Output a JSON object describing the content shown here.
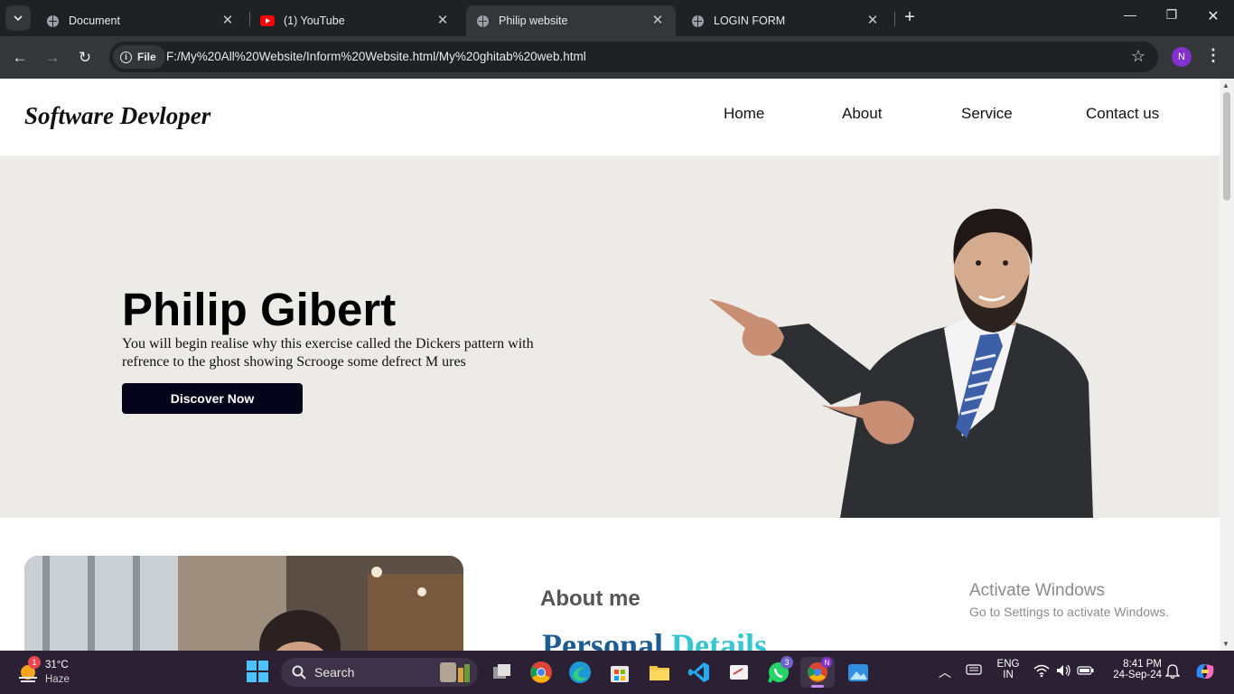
{
  "browser": {
    "tabs": [
      {
        "title": "Document",
        "icon": "globe-icon"
      },
      {
        "title": "(1) YouTube",
        "icon": "youtube-icon"
      },
      {
        "title": "Philip website",
        "icon": "globe-icon",
        "active": true
      },
      {
        "title": "LOGIN FORM",
        "icon": "globe-icon"
      }
    ],
    "chip_label": "File",
    "url": "F:/My%20All%20Website/Inform%20Website.html/My%20ghitab%20web.html",
    "profile_initial": "N"
  },
  "site": {
    "logo": "Software Devloper",
    "nav": [
      "Home",
      "About",
      "Service",
      "Contact us"
    ],
    "hero": {
      "name": "Philip Gibert",
      "text": "You will begin realise why this exercise called the Dickers pattern with refrence to the ghost showing Scrooge some defrect M ures",
      "button": "Discover Now"
    },
    "about": {
      "title": "About me",
      "subtitle_a": "Personal",
      "subtitle_b": "Details"
    }
  },
  "watermark": {
    "line1": "Activate Windows",
    "line2": "Go to Settings to activate Windows."
  },
  "taskbar": {
    "weather_temp": "31°C",
    "weather_desc": "Haze",
    "weather_badge": "1",
    "search_placeholder": "Search",
    "whatsapp_badge": "3",
    "lang_line1": "ENG",
    "lang_line2": "IN",
    "time": "8:41 PM",
    "date": "24-Sep-24"
  },
  "colors": {
    "hero_bg": "#edebe8",
    "button_bg": "#05041a",
    "accent_blue": "#1d5b91",
    "accent_cyan": "#35c6cf"
  }
}
